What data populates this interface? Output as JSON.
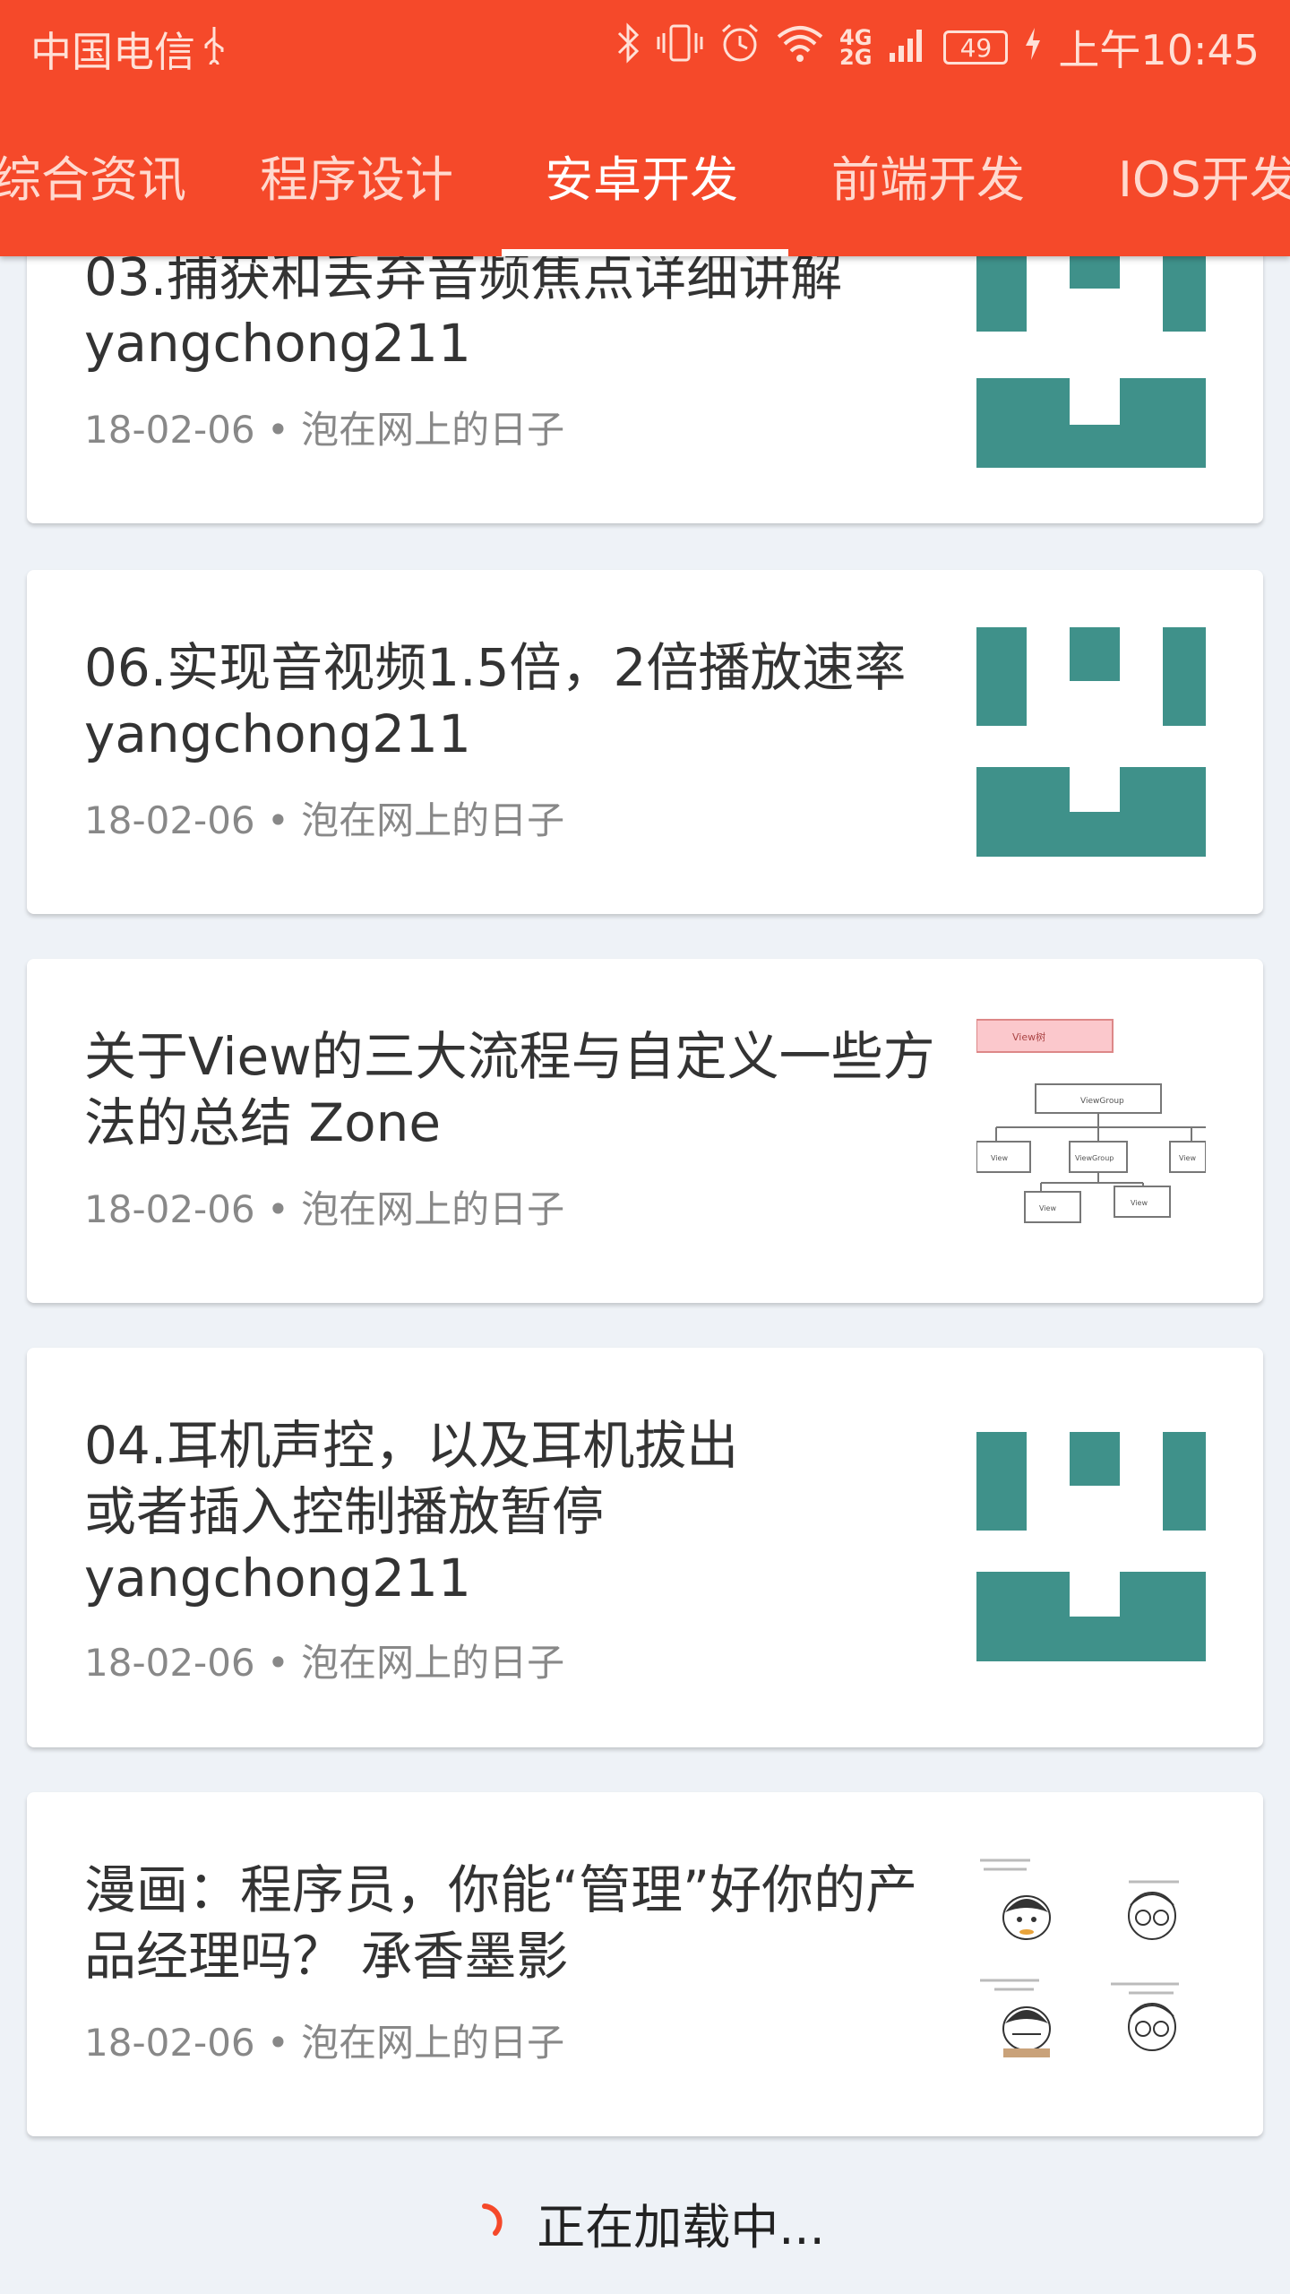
{
  "status_bar": {
    "carrier": "中国电信",
    "network": "4G\n2G",
    "battery": "49",
    "time": "上午10:45"
  },
  "tabs": [
    {
      "label": "综合资讯"
    },
    {
      "label": "程序设计"
    },
    {
      "label": "安卓开发"
    },
    {
      "label": "前端开发"
    },
    {
      "label": "IOS开发"
    }
  ],
  "colors": {
    "primary": "#f5492a",
    "thumb_teal": "#3f918a"
  },
  "articles": [
    {
      "title": "03.捕获和丢弃音频焦点详细讲解 yangchong211",
      "meta": "18-02-06 • 泡在网上的日子",
      "thumb": "teal-pattern"
    },
    {
      "title": "06.实现音视频1.5倍，2倍播放速率 yangchong211",
      "meta": "18-02-06 • 泡在网上的日子",
      "thumb": "teal-pattern"
    },
    {
      "title": "关于View的三大流程与自定义一些方法的总结 Zone",
      "meta": "18-02-06 • 泡在网上的日子",
      "thumb": "view-diagram",
      "diagram": {
        "top": "View树",
        "group": "ViewGroup",
        "nodes": [
          "View",
          "ViewGroup",
          "View",
          "View",
          "View"
        ]
      }
    },
    {
      "title": "04.耳机声控，以及耳机拔出或者插入控制播放暂停 yangchong211",
      "meta": "18-02-06 • 泡在网上的日子",
      "thumb": "teal-pattern"
    },
    {
      "title": "漫画：程序员，你能“管理”好你的产品经理吗？ 承香墨影",
      "meta": "18-02-06 • 泡在网上的日子",
      "thumb": "comic"
    }
  ],
  "loading": {
    "text": "正在加载中..."
  }
}
